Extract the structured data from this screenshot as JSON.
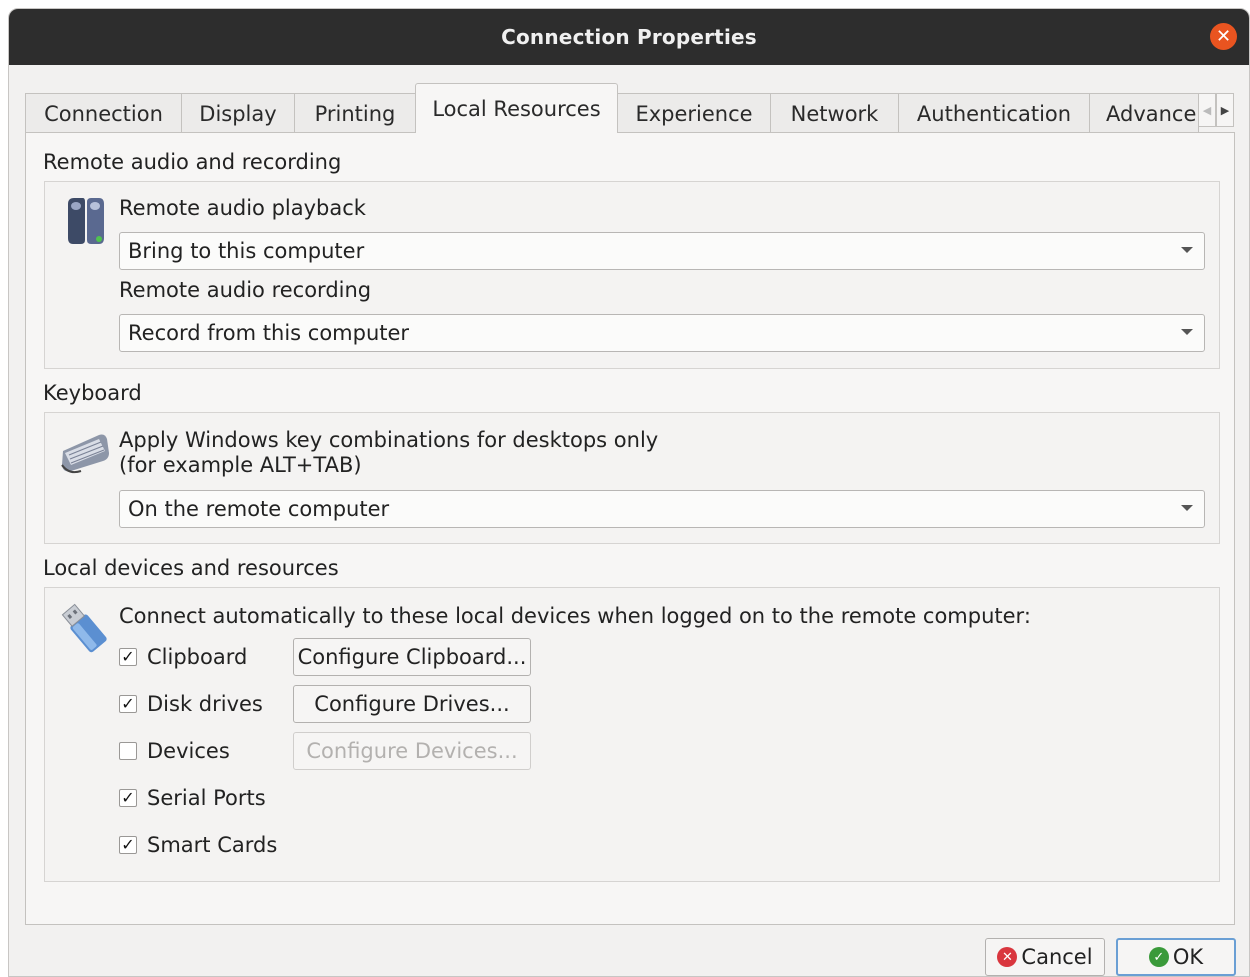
{
  "window": {
    "title": "Connection Properties"
  },
  "tabs": [
    "Connection",
    "Display",
    "Printing",
    "Local Resources",
    "Experience",
    "Network",
    "Authentication",
    "Advance"
  ],
  "active_tab": "Local Resources",
  "audio": {
    "section_title": "Remote audio and recording",
    "playback_label": "Remote audio playback",
    "playback_value": "Bring to this computer",
    "recording_label": "Remote audio recording",
    "recording_value": "Record from this computer"
  },
  "keyboard": {
    "section_title": "Keyboard",
    "label_line1": "Apply Windows key combinations for desktops only",
    "label_line2": "(for example ALT+TAB)",
    "value": "On the remote computer"
  },
  "devices": {
    "section_title": "Local devices and resources",
    "intro": "Connect automatically to these local devices when logged on to the remote computer:",
    "items": [
      {
        "label": "Clipboard",
        "checked": true,
        "button": "Configure Clipboard...",
        "button_enabled": true
      },
      {
        "label": "Disk drives",
        "checked": true,
        "button": "Configure Drives...",
        "button_enabled": true
      },
      {
        "label": "Devices",
        "checked": false,
        "button": "Configure Devices...",
        "button_enabled": false
      },
      {
        "label": "Serial Ports",
        "checked": true
      },
      {
        "label": "Smart Cards",
        "checked": true
      }
    ]
  },
  "footer": {
    "cancel_label": "Cancel",
    "ok_label": "OK"
  },
  "icons": {
    "close": "close-icon",
    "speakers": "speaker-icon",
    "keyboard": "keyboard-icon",
    "usb": "usb-drive-icon",
    "cancel": "cancel-icon",
    "ok": "check-circle-icon"
  },
  "colors": {
    "titlebar": "#2d2d2d",
    "close": "#e95420",
    "cancel_icon": "#d9363e",
    "ok_icon": "#3a9a3a",
    "ok_border": "#6a9fd4"
  }
}
